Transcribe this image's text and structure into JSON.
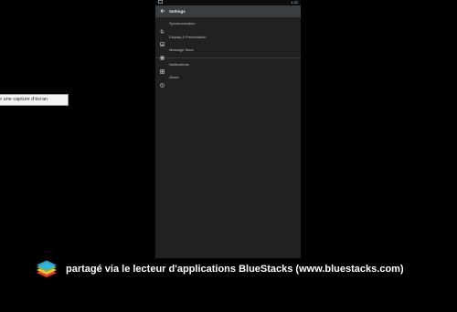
{
  "statusbar": {
    "left_text": "",
    "time": "1:22"
  },
  "appbar": {
    "back_icon": "arrow-left-icon",
    "title": "Settings"
  },
  "settings_items": [
    {
      "label": "Synchronization",
      "icon": "sync-icon"
    },
    {
      "label": "Display & Presentation",
      "icon": "image-icon"
    },
    {
      "label": "Message Store",
      "icon": "storage-icon"
    },
    {
      "label": "Notifications",
      "icon": "notification-icon"
    },
    {
      "label": "About",
      "icon": "info-icon"
    }
  ],
  "tooltip": {
    "text": "ire une capture d'écran"
  },
  "footer": {
    "logo": "bluestacks-logo-icon",
    "text": "partagé via le lecteur d'applications BlueStacks (www.bluestacks.com)"
  },
  "colors": {
    "background": "#000000",
    "phone_background": "#212121",
    "appbar": "#3b3e40",
    "text_primary": "#ffffff"
  }
}
